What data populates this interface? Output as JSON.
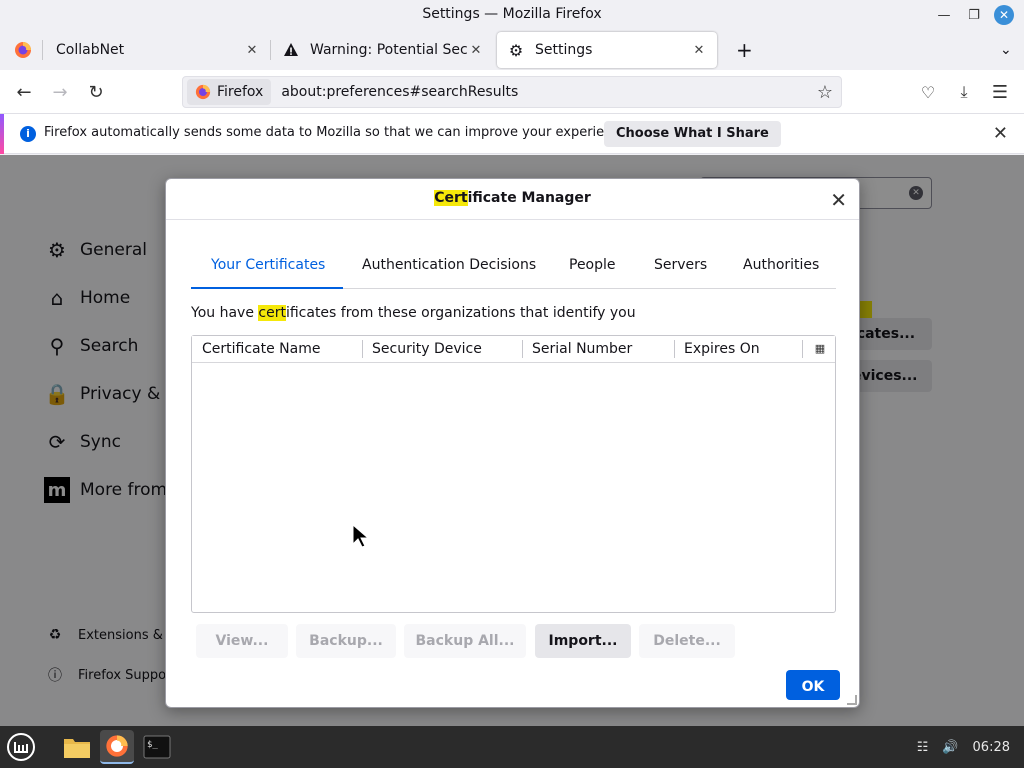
{
  "window": {
    "title": "Settings — Mozilla Firefox"
  },
  "tabs": [
    {
      "label": "CollabNet",
      "icon": "firefox-icon"
    },
    {
      "label": "Warning: Potential Security",
      "icon": "warning-icon"
    },
    {
      "label": "Settings",
      "icon": "gear-icon"
    }
  ],
  "navbar": {
    "identity_label": "Firefox",
    "url": "about:preferences#searchResults"
  },
  "notification": {
    "message": "Firefox automatically sends some data to Mozilla so that we can improve your experience.",
    "button_label": "Choose What I Share"
  },
  "settings_bg": {
    "categories": [
      {
        "label": "General",
        "icon": "gear-icon"
      },
      {
        "label": "Home",
        "icon": "home-icon"
      },
      {
        "label": "Search",
        "icon": "search-icon"
      },
      {
        "label": "Privacy & Se",
        "icon": "lock-icon"
      },
      {
        "label": "Sync",
        "icon": "sync-icon"
      },
      {
        "label": "More from M",
        "icon": "mozilla-icon"
      }
    ],
    "footer_links": [
      {
        "label": "Extensions & T",
        "icon": "extensions-icon"
      },
      {
        "label": "Firefox Suppo",
        "icon": "help-icon"
      }
    ],
    "buttons": [
      "icates...",
      "evices..."
    ]
  },
  "dialog": {
    "title_highlight": "Cert",
    "title_rest": "ificate Manager",
    "tabs": [
      "Your Certificates",
      "Authentication Decisions",
      "People",
      "Servers",
      "Authorities"
    ],
    "selected_tab": 0,
    "description_before": "You have ",
    "description_highlight": "cert",
    "description_after": "ificates from these organizations that identify you",
    "columns": [
      "Certificate Name",
      "Security Device",
      "Serial Number",
      "Expires On"
    ],
    "rows": [],
    "buttons": {
      "view": "View...",
      "backup": "Backup...",
      "backup_all": "Backup All...",
      "import": "Import...",
      "delete": "Delete..."
    },
    "ok_label": "OK"
  },
  "taskbar": {
    "time": "06:28"
  },
  "colors": {
    "accent": "#0060df",
    "highlight": "#f5e80a",
    "taskbar": "#2b2b2b"
  }
}
